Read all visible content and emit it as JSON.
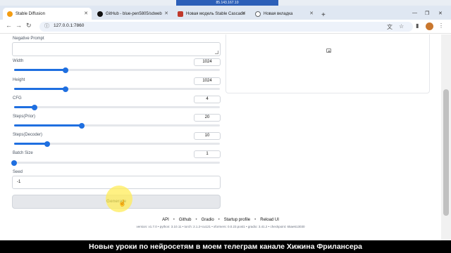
{
  "rdp": {
    "host": "85.143.167.10"
  },
  "tabs": [
    {
      "title": "Stable Diffusion",
      "active": true,
      "favicon_color": "#f39c12"
    },
    {
      "title": "GitHub - blue-pen5805/sdweb",
      "active": false,
      "favicon_color": "#111111"
    },
    {
      "title": "Новая модель Stable Cascade",
      "active": false,
      "favicon_color": "#c0392b"
    },
    {
      "title": "Новая вкладка",
      "active": false,
      "favicon_color": "#5f6368"
    }
  ],
  "address": {
    "url": "127.0.0.1:7860"
  },
  "form": {
    "negative_prompt_label": "Negative Prompt",
    "width": {
      "label": "Width",
      "value": "1024",
      "fraction": 0.25
    },
    "height": {
      "label": "Height",
      "value": "1024",
      "fraction": 0.25
    },
    "cfg": {
      "label": "CFG",
      "value": "4",
      "fraction": 0.1
    },
    "steps_prior": {
      "label": "Steps(Prior)",
      "value": "20",
      "fraction": 0.33
    },
    "steps_decoder": {
      "label": "Steps(Decoder)",
      "value": "10",
      "fraction": 0.16
    },
    "batch_size": {
      "label": "Batch Size",
      "value": "1",
      "fraction": 0.0
    },
    "seed": {
      "label": "Seed",
      "value": "-1"
    },
    "generate_label": "Generate"
  },
  "footer": {
    "links": [
      "API",
      "Github",
      "Gradio",
      "Startup profile",
      "Reload UI"
    ],
    "info": "version: v1.7.0  •  python: 3.10.11  •  torch: 2.1.2+cu121  •  xformers: 0.0.23.post1  •  gradio: 3.41.2  •  checkpoint: 65ae613030"
  },
  "banner": "Новые уроки по нейросетям в моем телеграм канале Хижина Фрилансера",
  "colors": {
    "accent": "#1f6fe0",
    "highlight": "#ffec5a"
  }
}
